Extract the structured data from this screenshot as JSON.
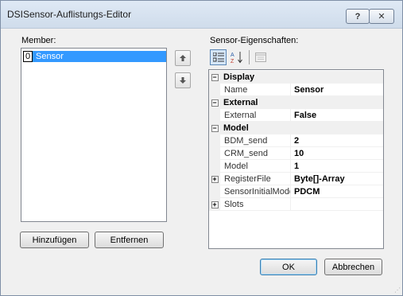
{
  "window": {
    "title": "DSISensor-Auflistungs-Editor",
    "help_label": "?",
    "close_label": "✕"
  },
  "members": {
    "label": "Member:",
    "items": [
      {
        "index": "0",
        "name": "Sensor",
        "selected": true
      }
    ],
    "up_icon": "up-arrow-icon",
    "down_icon": "down-arrow-icon",
    "add_label": "Hinzufügen",
    "remove_label": "Entfernen"
  },
  "properties": {
    "label": "Sensor-Eigenschaften:",
    "toolbar": {
      "categorized_icon": "categorized-icon",
      "alphabetical_icon": "alphabetical-icon",
      "property_pages_icon": "property-pages-icon"
    },
    "rows": [
      {
        "type": "category",
        "name": "Display",
        "expander": "⊟"
      },
      {
        "type": "property",
        "name": "Name",
        "value": "Sensor"
      },
      {
        "type": "category",
        "name": "External",
        "expander": "⊟"
      },
      {
        "type": "property",
        "name": "External",
        "value": "False"
      },
      {
        "type": "category",
        "name": "Model",
        "expander": "⊟"
      },
      {
        "type": "property",
        "name": "BDM_send",
        "value": "2"
      },
      {
        "type": "property",
        "name": "CRM_send",
        "value": "10"
      },
      {
        "type": "property",
        "name": "Model",
        "value": "1"
      },
      {
        "type": "property",
        "name": "RegisterFile",
        "value": "Byte[]-Array",
        "expander": "⊞"
      },
      {
        "type": "property",
        "name": "SensorInitialMode",
        "value": "PDCM"
      },
      {
        "type": "property",
        "name": "Slots",
        "value": "",
        "expander": "⊞"
      }
    ]
  },
  "footer": {
    "ok_label": "OK",
    "cancel_label": "Abbrechen"
  },
  "colors": {
    "selection": "#3399ff",
    "title_bar": "#cfdceb"
  }
}
